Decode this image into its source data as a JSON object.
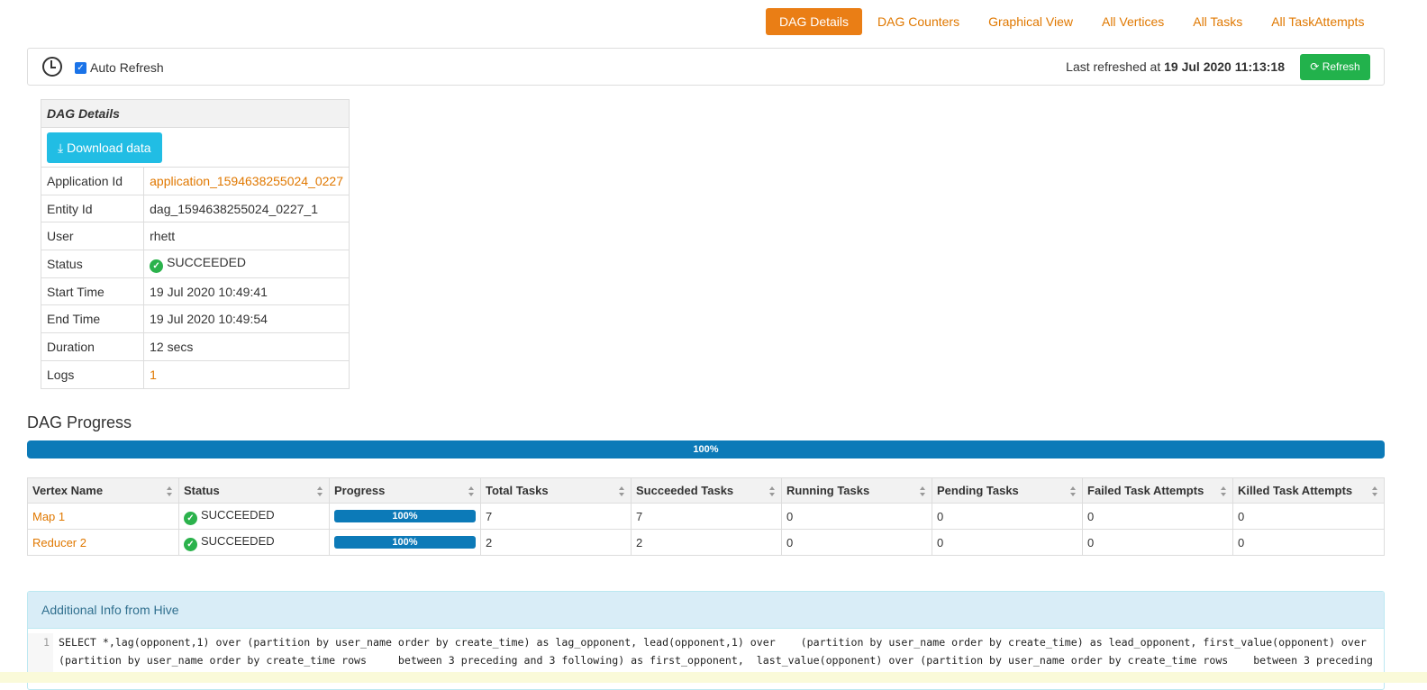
{
  "nav": {
    "tabs": [
      "DAG Details",
      "DAG Counters",
      "Graphical View",
      "All Vertices",
      "All Tasks",
      "All TaskAttempts"
    ],
    "active": "DAG Details"
  },
  "refresh": {
    "auto_refresh_label": "Auto Refresh",
    "auto_refresh_checked": true,
    "last_refreshed_prefix": "Last refreshed at",
    "last_refreshed_time": "19 Jul 2020 11:13:18",
    "refresh_button": "Refresh"
  },
  "details": {
    "title": "DAG Details",
    "download_label": "Download data",
    "rows": [
      {
        "label": "Application Id",
        "value": "application_1594638255024_0227"
      },
      {
        "label": "Entity Id",
        "value": "dag_1594638255024_0227_1"
      },
      {
        "label": "User",
        "value": "rhett"
      },
      {
        "label": "Status",
        "value": "SUCCEEDED"
      },
      {
        "label": "Start Time",
        "value": "19 Jul 2020 10:49:41"
      },
      {
        "label": "End Time",
        "value": "19 Jul 2020 10:49:54"
      },
      {
        "label": "Duration",
        "value": "12 secs"
      },
      {
        "label": "Logs",
        "value": "1"
      }
    ]
  },
  "progress": {
    "title": "DAG Progress",
    "label": "100%",
    "fraction": 1.0
  },
  "vertices": {
    "columns": [
      "Vertex Name",
      "Status",
      "Progress",
      "Total Tasks",
      "Succeeded Tasks",
      "Running Tasks",
      "Pending Tasks",
      "Failed Task Attempts",
      "Killed Task Attempts"
    ],
    "rows": [
      {
        "name": "Map 1",
        "status": "SUCCEEDED",
        "progress": "100%",
        "total": "7",
        "succeeded": "7",
        "running": "0",
        "pending": "0",
        "failed": "0",
        "killed": "0"
      },
      {
        "name": "Reducer 2",
        "status": "SUCCEEDED",
        "progress": "100%",
        "total": "2",
        "succeeded": "2",
        "running": "0",
        "pending": "0",
        "failed": "0",
        "killed": "0"
      }
    ]
  },
  "hive": {
    "title": "Additional Info from Hive",
    "line_number": "1",
    "line1": "SELECT *,lag(opponent,1) over (partition by user_name order by create_time) as lag_opponent, lead(opponent,1) over    (partition by user_name order by create_time) as lead_opponent, first_value(opponent) over",
    "line2": "(partition by user_name order by create_time rows     between 3 preceding and 3 following) as first_opponent,  last_value(opponent) over (partition by user_name order by create_time rows    between 3 preceding"
  }
}
